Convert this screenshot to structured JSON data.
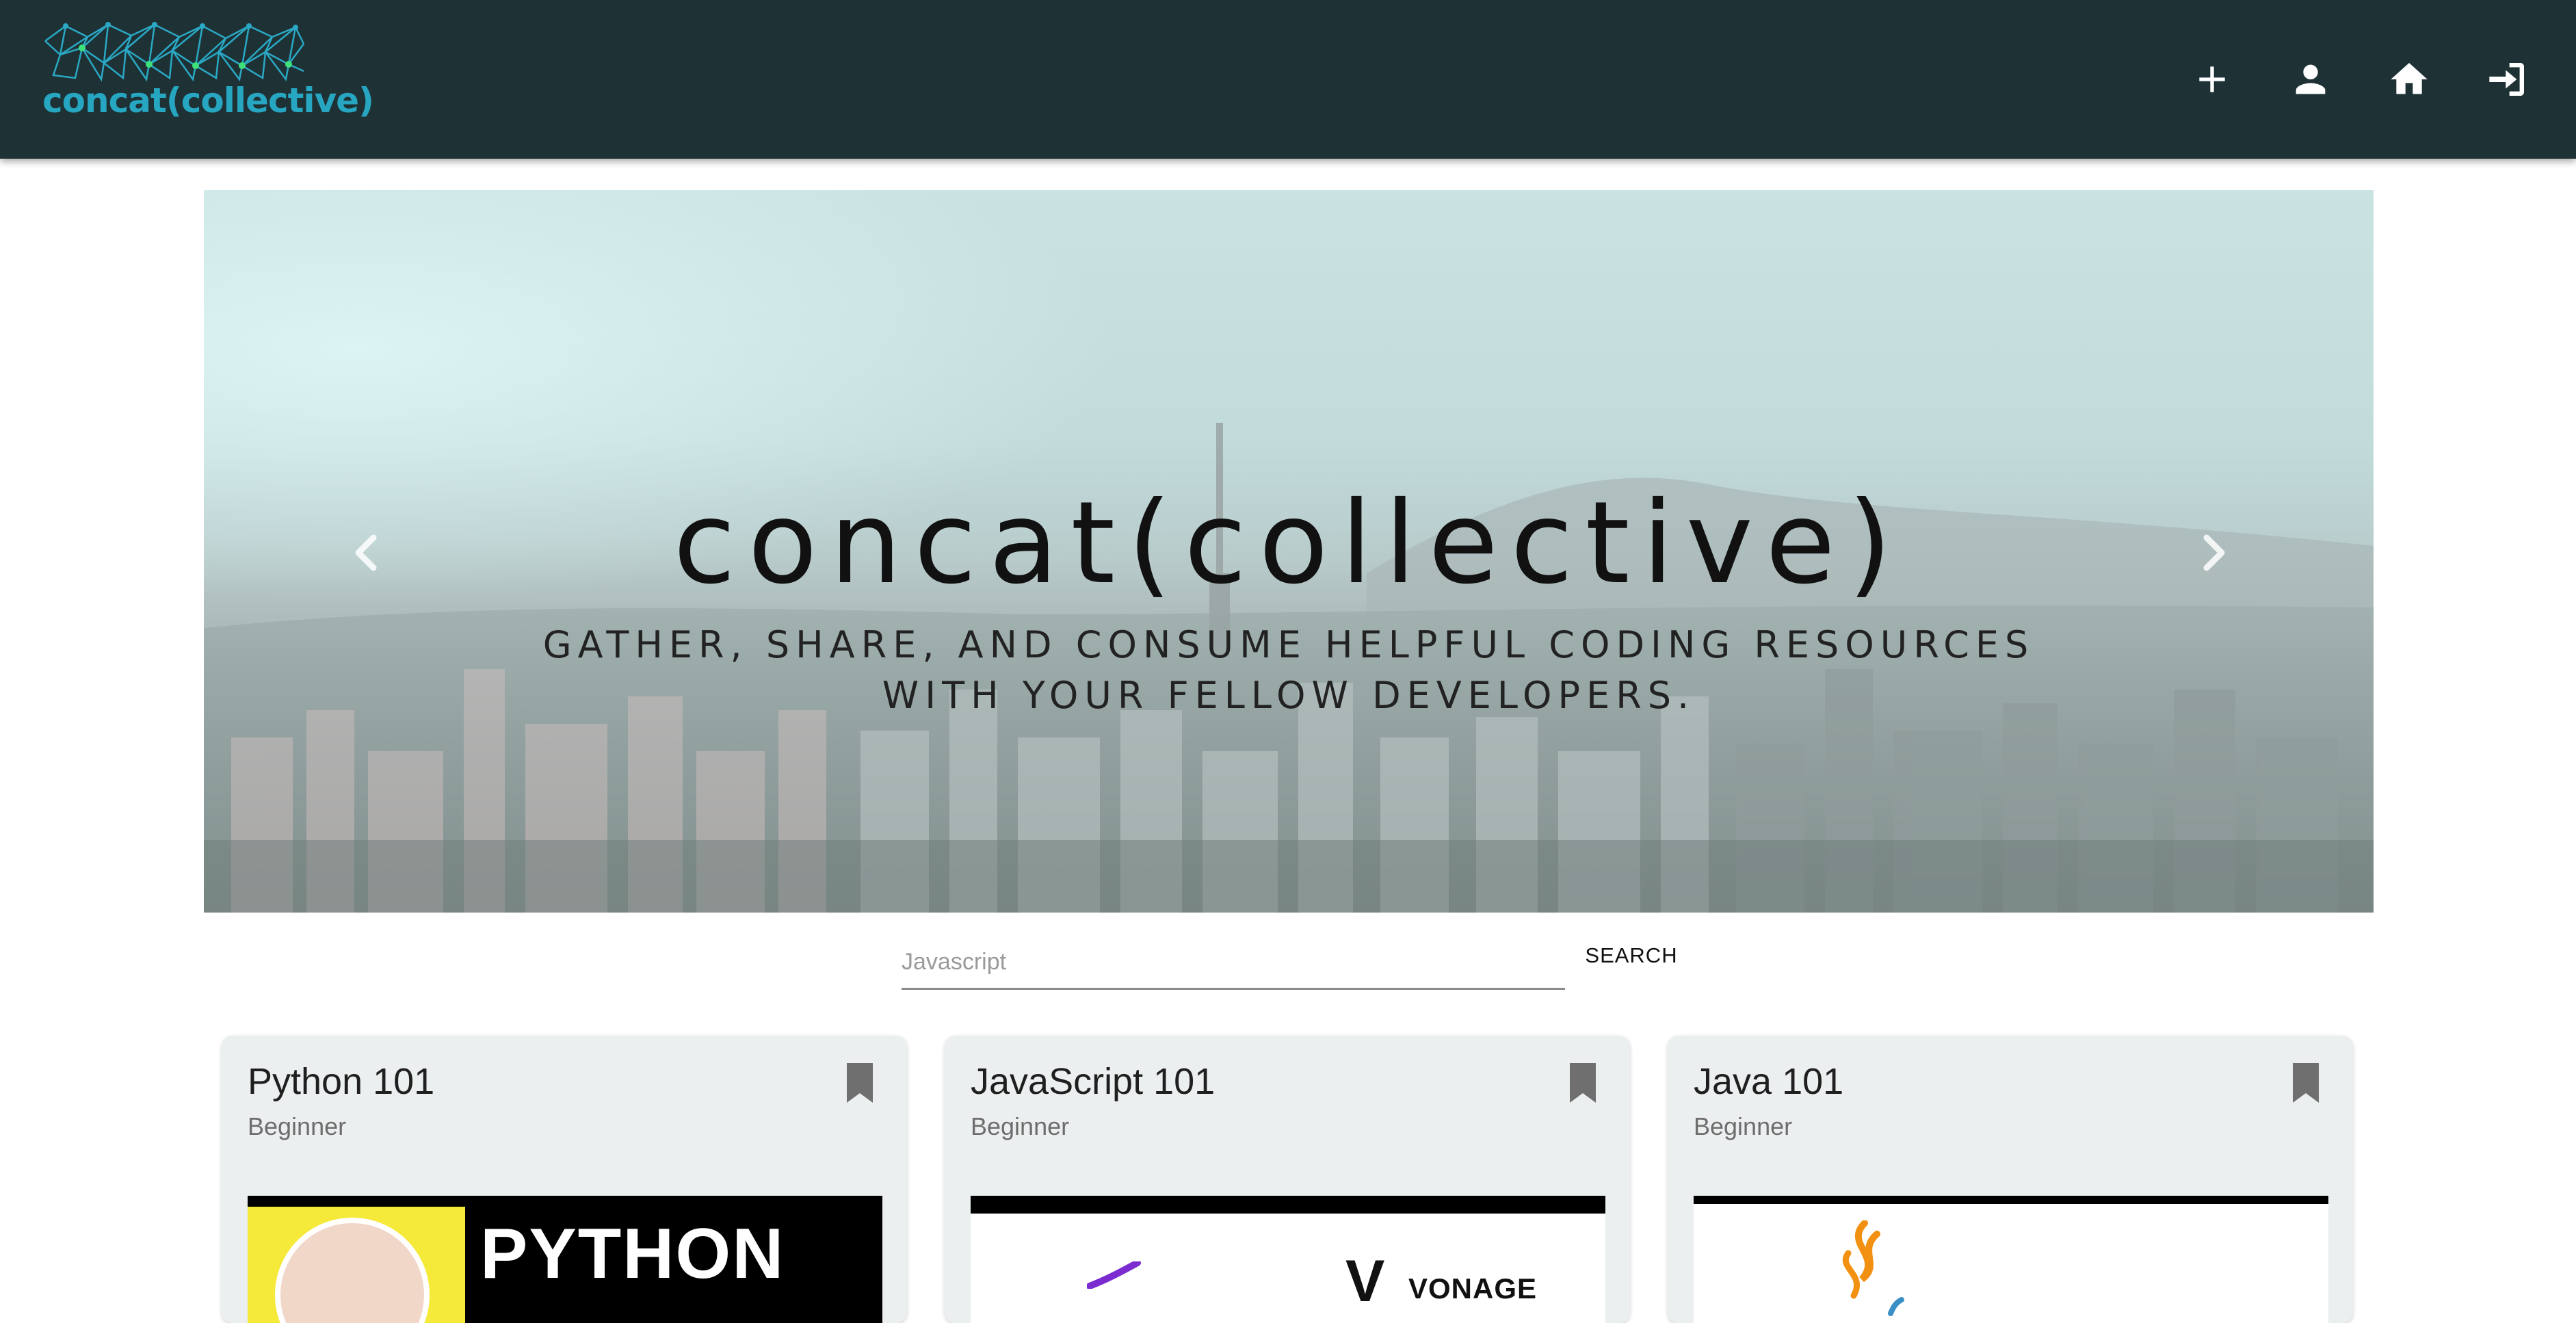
{
  "header": {
    "logo_text": "concat(collective)",
    "nav": [
      {
        "icon": "plus-icon"
      },
      {
        "icon": "person-icon"
      },
      {
        "icon": "home-icon"
      },
      {
        "icon": "login-icon"
      }
    ]
  },
  "hero": {
    "title": "concat(collective)",
    "subtitle": "GATHER, SHARE, AND CONSUME HELPFUL CODING RESOURCES WITH YOUR FELLOW DEVELOPERS."
  },
  "search": {
    "placeholder": "Javascript",
    "button_label": "SEARCH"
  },
  "cards": [
    {
      "title": "Python 101",
      "level": "Beginner",
      "image_text": "PYTHON"
    },
    {
      "title": "JavaScript 101",
      "level": "Beginner",
      "image_text": "VONAGE"
    },
    {
      "title": "Java 101",
      "level": "Beginner",
      "image_text": ""
    }
  ],
  "colors": {
    "header_bg": "#1e3236",
    "logo_accent": "#27a6c2",
    "card_bg": "#eceff0"
  }
}
